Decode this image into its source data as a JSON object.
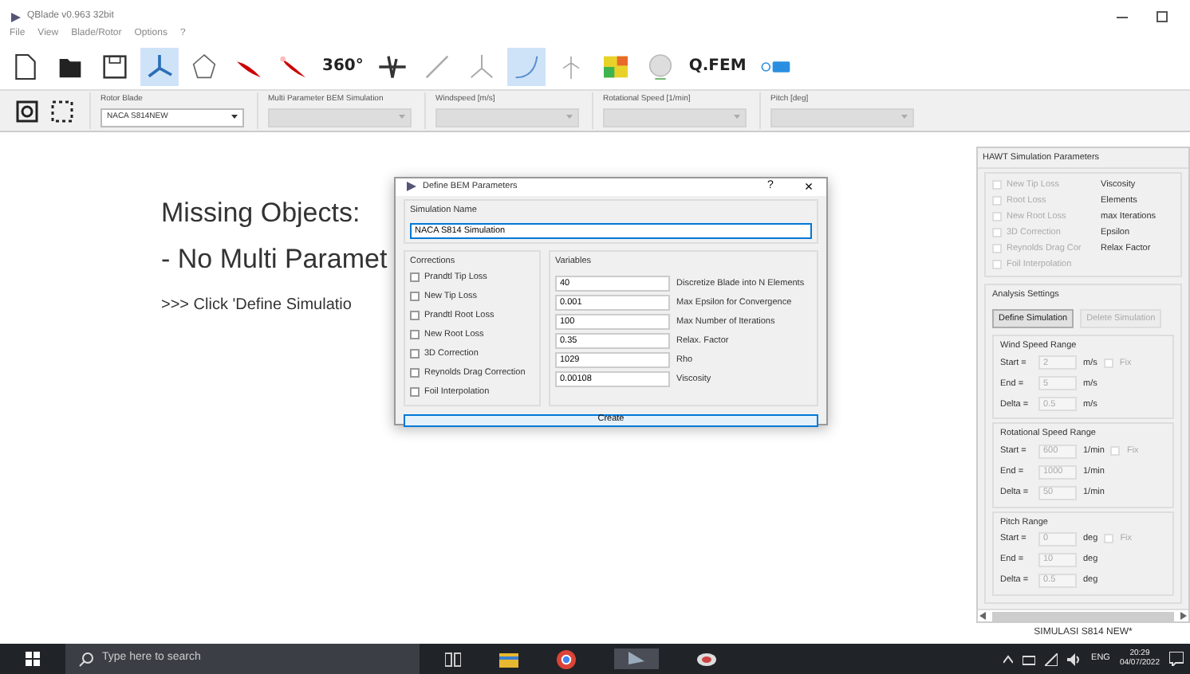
{
  "window": {
    "title": "QBlade v0.963 32bit"
  },
  "menu": [
    "File",
    "View",
    "Blade/Rotor",
    "Options",
    "?"
  ],
  "toolbar": [
    {
      "kind": "icon",
      "selected": false
    },
    {
      "kind": "icon",
      "selected": false
    },
    {
      "kind": "icon",
      "selected": false
    },
    {
      "kind": "icon",
      "selected": true
    },
    {
      "kind": "icon",
      "selected": false
    },
    {
      "kind": "icon",
      "selected": false
    },
    {
      "kind": "icon",
      "selected": false
    },
    {
      "kind": "text",
      "label": "360°",
      "selected": false
    },
    {
      "kind": "icon",
      "selected": false
    },
    {
      "kind": "icon",
      "selected": false
    },
    {
      "kind": "icon",
      "selected": false
    },
    {
      "kind": "icon",
      "selected": true
    },
    {
      "kind": "icon",
      "selected": false
    },
    {
      "kind": "icon",
      "selected": false
    },
    {
      "kind": "icon",
      "selected": false
    },
    {
      "kind": "text",
      "label": "Q.FEM",
      "selected": false
    },
    {
      "kind": "icon",
      "selected": false
    }
  ],
  "selectors": [
    {
      "label": "Rotor Blade",
      "value": "NACA S814NEW",
      "disabled": false
    },
    {
      "label": "Multi Parameter BEM Simulation",
      "disabled": true
    },
    {
      "label": "Windspeed [m/s]",
      "disabled": true
    },
    {
      "label": "Rotational Speed [1/min]",
      "disabled": true
    },
    {
      "label": "Pitch [deg]",
      "disabled": true
    }
  ],
  "message": {
    "title": "Missing Objects:",
    "line": "- No Multi Paramet",
    "hint": ">>> Click 'Define Simulatio"
  },
  "dialog": {
    "title": "Define BEM Parameters",
    "help": "?",
    "close": "×",
    "name_label": "Simulation Name",
    "name_value": "NACA S814 Simulation",
    "corrections_label": "Corrections",
    "corrections": [
      {
        "label": "Prandtl Tip Loss",
        "checked": false
      },
      {
        "label": "New Tip Loss",
        "checked": false
      },
      {
        "label": "Prandtl Root Loss",
        "checked": false
      },
      {
        "label": "New Root Loss",
        "checked": false
      },
      {
        "label": "3D Correction",
        "checked": false
      },
      {
        "label": "Reynolds Drag Correction",
        "checked": false
      },
      {
        "label": "Foil Interpolation",
        "checked": false
      }
    ],
    "variables_label": "Variables",
    "variables": [
      {
        "value": "40",
        "label": "Discretize Blade into N Elements"
      },
      {
        "value": "0.001",
        "label": "Max Epsilon for Convergence"
      },
      {
        "value": "100",
        "label": "Max Number of Iterations"
      },
      {
        "value": "0.35",
        "label": "Relax. Factor"
      },
      {
        "value": "1029",
        "label": "Rho"
      },
      {
        "value": "0.00108",
        "label": "Viscosity"
      }
    ],
    "create": "Create"
  },
  "panel": {
    "title": "HAWT Simulation Parameters",
    "options": [
      {
        "label": "New Tip Loss",
        "checked": false,
        "disabled": true,
        "note": "Viscosity"
      },
      {
        "label": "Root Loss",
        "checked": false,
        "disabled": true,
        "note": "Elements"
      },
      {
        "label": "New Root Loss",
        "checked": false,
        "disabled": true,
        "note": "max Iterations"
      },
      {
        "label": "3D Correction",
        "checked": false,
        "disabled": true,
        "note": "Epsilon"
      },
      {
        "label": "Reynolds Drag Cor",
        "checked": false,
        "disabled": true,
        "note": "Relax Factor"
      },
      {
        "label": "Foil Interpolation",
        "checked": false,
        "disabled": true
      }
    ],
    "analysis_label": "Analysis Settings",
    "buttons": [
      {
        "label": "Define Simulation",
        "disabled": false
      },
      {
        "label": "Delete Simulation",
        "disabled": true
      }
    ],
    "ranges": [
      {
        "title": "Wind Speed Range",
        "fix": {
          "label": "Fix",
          "checked": false
        },
        "rows": [
          {
            "label": "Start =",
            "value": "2",
            "unit": "m/s",
            "disabled": true
          },
          {
            "label": "End =",
            "value": "5",
            "unit": "m/s",
            "disabled": true
          },
          {
            "label": "Delta =",
            "value": "0.5",
            "unit": "m/s",
            "disabled": true
          }
        ]
      },
      {
        "title": "Rotational Speed Range",
        "fix": {
          "label": "Fix",
          "checked": false
        },
        "rows": [
          {
            "label": "Start =",
            "value": "600",
            "unit": "1/min",
            "disabled": true
          },
          {
            "label": "End =",
            "value": "1000",
            "unit": "1/min",
            "disabled": true
          },
          {
            "label": "Delta =",
            "value": "50",
            "unit": "1/min",
            "disabled": true
          }
        ]
      },
      {
        "title": "Pitch Range",
        "fix": {
          "label": "Fix",
          "checked": false
        },
        "rows": [
          {
            "label": "Start =",
            "value": "0",
            "unit": "deg",
            "disabled": true
          },
          {
            "label": "End =",
            "value": "10",
            "unit": "deg",
            "disabled": true
          },
          {
            "label": "Delta =",
            "value": "0.5",
            "unit": "deg",
            "disabled": true
          }
        ]
      }
    ]
  },
  "status": "SIMULASI S814 NEW*",
  "taskbar": {
    "search_placeholder": "Type here to search",
    "language": "ENG",
    "time": "20:29",
    "date": "04/07/2022"
  }
}
